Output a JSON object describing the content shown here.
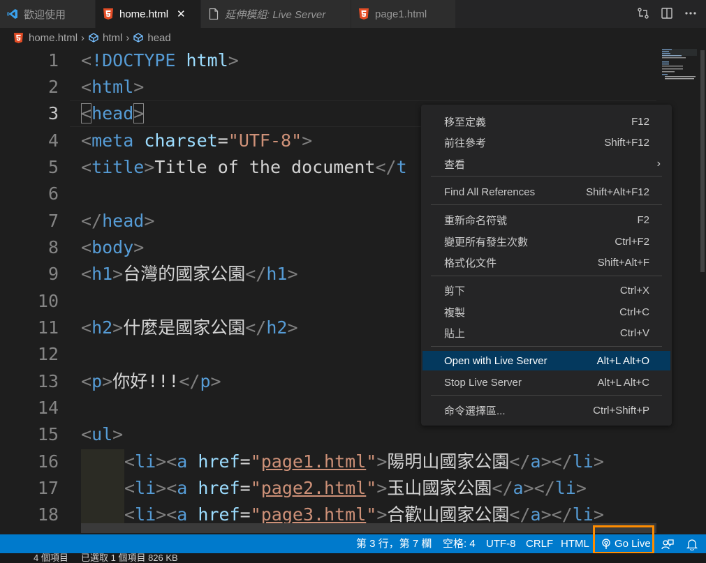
{
  "tabs": [
    {
      "label": "歡迎使用",
      "icon": "vscode-logo-icon"
    },
    {
      "label": "home.html",
      "icon": "html5-icon",
      "close": "✕"
    },
    {
      "label": "延伸模組: Live Server",
      "icon": "file-icon"
    },
    {
      "label": "page1.html",
      "icon": "html5-icon"
    }
  ],
  "breadcrumb": [
    "home.html",
    "html",
    "head"
  ],
  "line_numbers": [
    "1",
    "2",
    "3",
    "4",
    "5",
    "6",
    "7",
    "8",
    "9",
    "10",
    "11",
    "12",
    "13",
    "14",
    "15",
    "16",
    "17",
    "18"
  ],
  "code": {
    "l1": {
      "a": "<",
      "b": "!DOCTYPE",
      "c": " html",
      "d": ">"
    },
    "l2": {
      "a": "<",
      "b": "html",
      "c": ">"
    },
    "l3": {
      "a": "<",
      "b": "head",
      "c": ">"
    },
    "l4": {
      "a": "<",
      "b": "meta",
      "c": " charset",
      "d": "=",
      "e": "\"UTF-8\"",
      "f": ">"
    },
    "l5": {
      "a": "<",
      "b": "title",
      "c": ">",
      "d": "Title of the document",
      "e": "</",
      "f": "t"
    },
    "l7": {
      "a": "</",
      "b": "head",
      "c": ">"
    },
    "l8": {
      "a": "<",
      "b": "body",
      "c": ">"
    },
    "l9": {
      "a": "<",
      "b": "h1",
      "c": ">",
      "d": "台灣的國家公園",
      "e": "</",
      "f": "h1",
      "g": ">"
    },
    "l11": {
      "a": "<",
      "b": "h2",
      "c": ">",
      "d": "什麼是國家公園",
      "e": "</",
      "f": "h2",
      "g": ">"
    },
    "l13": {
      "a": "<",
      "b": "p",
      "c": ">",
      "d": "你好!!!",
      "e": "</",
      "f": "p",
      "g": ">"
    },
    "l15": {
      "a": "<",
      "b": "ul",
      "c": ">"
    },
    "l16": {
      "href": "page1.html",
      "text": "陽明山國家公園"
    },
    "l17": {
      "href": "page2.html",
      "text": "玉山國家公園"
    },
    "l18": {
      "href": "page3.html",
      "text": "合歡山國家公園"
    },
    "li_open": "<",
    "li": "li",
    "close": ">",
    "a_tag": "a",
    "href_attr": " href",
    "eq": "=",
    "quote": "\"",
    "end_a": "</",
    "end_li": "</"
  },
  "context_menu": [
    {
      "label": "移至定義",
      "key": "F12"
    },
    {
      "label": "前往參考",
      "key": "Shift+F12"
    },
    {
      "label": "查看",
      "key": "",
      "arrow": "›"
    },
    {
      "label": "Find All References",
      "key": "Shift+Alt+F12"
    },
    {
      "label": "重新命名符號",
      "key": "F2"
    },
    {
      "label": "變更所有發生次數",
      "key": "Ctrl+F2"
    },
    {
      "label": "格式化文件",
      "key": "Shift+Alt+F"
    },
    {
      "label": "剪下",
      "key": "Ctrl+X"
    },
    {
      "label": "複製",
      "key": "Ctrl+C"
    },
    {
      "label": "貼上",
      "key": "Ctrl+V"
    },
    {
      "label": "Open with Live Server",
      "key": "Alt+L Alt+O"
    },
    {
      "label": "Stop Live Server",
      "key": "Alt+L Alt+C"
    },
    {
      "label": "命令選擇區...",
      "key": "Ctrl+Shift+P"
    }
  ],
  "status": {
    "position": "第 3 行，第 7 欄",
    "spaces": "空格: 4",
    "encoding": "UTF-8",
    "eol": "CRLF",
    "language": "HTML",
    "golive": "Go Live"
  },
  "explorer_status": {
    "items": "4 個項目",
    "selected": "已選取 1 個項目 826 KB"
  },
  "colors": {
    "accent": "#007acc",
    "highlight_box": "#ff8c00",
    "menu_selected": "#04395e"
  }
}
